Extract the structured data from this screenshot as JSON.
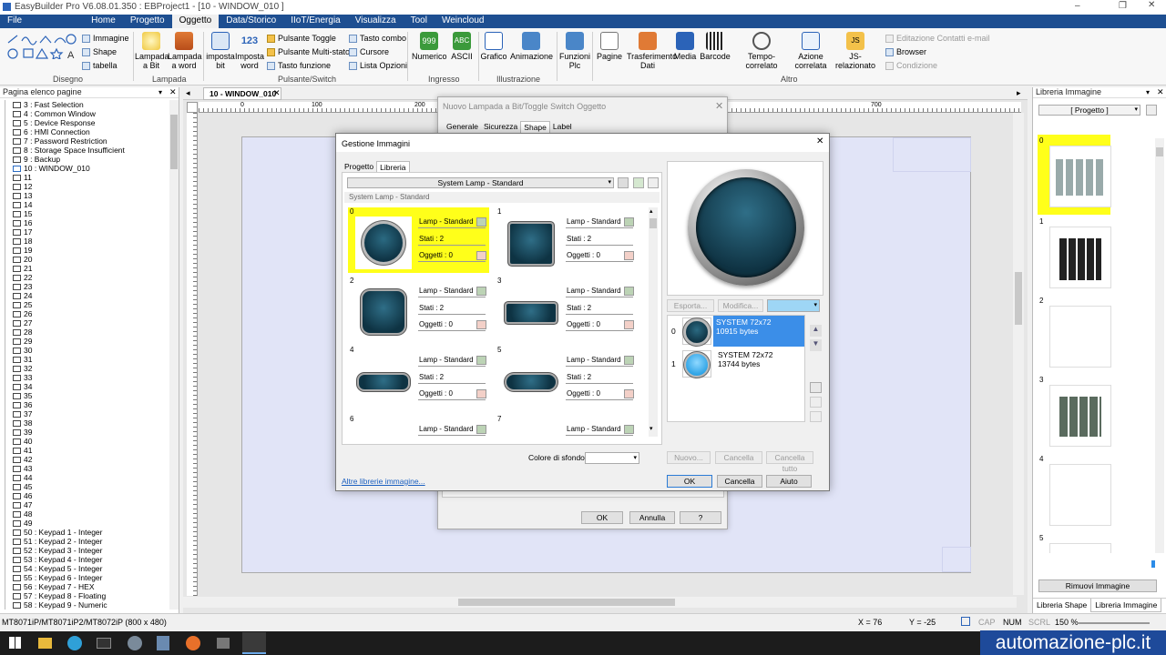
{
  "title": "EasyBuilder Pro V6.08.01.350 : EBProject1 - [10 - WINDOW_010 ]",
  "menu": [
    "File",
    "Home",
    "Progetto",
    "Oggetto",
    "Data/Storico",
    "IIoT/Energia",
    "Visualizza",
    "Tool",
    "Weincloud"
  ],
  "ribbon": {
    "disegno": {
      "label": "Disegno",
      "immagine": "Immagine",
      "shape": "Shape",
      "tabella": "tabella"
    },
    "lampada": {
      "label": "Lampada",
      "bit": "Lampada a Bit",
      "word": "Lampada a word"
    },
    "pulsante": {
      "label": "Pulsante/Switch",
      "imposta_bit": "imposta bit",
      "imposta_word": "Imposta word",
      "toggle": "Pulsante Toggle",
      "multi": "Pulsante Multi-stato",
      "funzione": "Tasto funzione",
      "combo": "Tasto combo",
      "cursore": "Cursore",
      "lista": "Lista Opzioni"
    },
    "ingresso": {
      "label": "Ingresso",
      "numerico": "Numerico",
      "ascii": "ASCII"
    },
    "illustrazione": {
      "label": "Illustrazione",
      "grafico": "Grafico",
      "animazione": "Animazione"
    },
    "funzioni_plc": "Funzioni Plc",
    "altro": {
      "label": "Altro",
      "pagine": "Pagine",
      "trasferimento": "Trasferimento Dati",
      "media": "Media",
      "barcode": "Barcode",
      "tempo": "Tempo-correlato",
      "azione": "Azione correlata",
      "js": "JS-relazionato",
      "edit_contatti": "Editazione Contatti e-mail",
      "browser": "Browser",
      "condizione": "Condizione"
    }
  },
  "left_panel": {
    "header": "Pagina elenco pagine",
    "pages": [
      "3 : Fast Selection",
      "4 : Common Window",
      "5 : Device Response",
      "6 : HMI Connection",
      "7 : Password Restriction",
      "8 : Storage Space Insufficient",
      "9 : Backup",
      "10 : WINDOW_010",
      "11",
      "12",
      "13",
      "14",
      "15",
      "16",
      "17",
      "18",
      "19",
      "20",
      "21",
      "22",
      "23",
      "24",
      "25",
      "26",
      "27",
      "28",
      "29",
      "30",
      "31",
      "32",
      "33",
      "34",
      "35",
      "36",
      "37",
      "38",
      "39",
      "40",
      "41",
      "42",
      "43",
      "44",
      "45",
      "46",
      "47",
      "48",
      "49",
      "50 : Keypad 1 - Integer",
      "51 : Keypad 2 - Integer",
      "52 : Keypad 3 - Integer",
      "53 : Keypad 4 - Integer",
      "54 : Keypad 5 - Integer",
      "55 : Keypad 6 - Integer",
      "56 : Keypad 7 - HEX",
      "57 : Keypad 8 - Floating",
      "58 : Keypad 9 - Numeric"
    ]
  },
  "doc_tab": "10 - WINDOW_010",
  "ruler_ticks": [
    "0",
    "100",
    "200",
    "700"
  ],
  "bg_dialog": {
    "title": "Nuovo  Lampada a Bit/Toggle Switch Oggetto",
    "tabs": [
      "Generale",
      "Sicurezza",
      "Shape",
      "Label"
    ],
    "ok": "OK",
    "annulla": "Annulla",
    "help": "?"
  },
  "dialog": {
    "title": "Gestione Immagini",
    "tabs": [
      "Progetto",
      "Libreria"
    ],
    "library_select": "System Lamp - Standard",
    "library_caption": "System Lamp - Standard",
    "items": [
      {
        "id": "0",
        "name": "Lamp - Standard",
        "stati": "Stati : 2",
        "oggetti": "Oggetti : 0"
      },
      {
        "id": "1",
        "name": "Lamp - Standard",
        "stati": "Stati : 2",
        "oggetti": "Oggetti : 0"
      },
      {
        "id": "2",
        "name": "Lamp - Standard",
        "stati": "Stati : 2",
        "oggetti": "Oggetti : 0"
      },
      {
        "id": "3",
        "name": "Lamp - Standard",
        "stati": "Stati : 2",
        "oggetti": "Oggetti : 0"
      },
      {
        "id": "4",
        "name": "Lamp - Standard",
        "stati": "Stati : 2",
        "oggetti": "Oggetti : 0"
      },
      {
        "id": "5",
        "name": "Lamp - Standard",
        "stati": "Stati : 2",
        "oggetti": "Oggetti : 0"
      },
      {
        "id": "6",
        "name": "Lamp - Standard"
      },
      {
        "id": "7",
        "name": "Lamp - Standard"
      }
    ],
    "esporta": "Esporta...",
    "modifica": "Modifica...",
    "states": [
      {
        "idx": "0",
        "name": "SYSTEM 72x72",
        "size": "10915 bytes"
      },
      {
        "idx": "1",
        "name": "SYSTEM 72x72",
        "size": "13744 bytes"
      }
    ],
    "nuovo": "Nuovo...",
    "cancella": "Cancella",
    "cancella_tutto": "Cancella tutto",
    "sfondo_label": "Colore di sfondo :",
    "link": "Altre librerie immagine...",
    "ok": "OK",
    "cancel": "Cancella",
    "help": "Aiuto",
    "selected_color": "#ffff1a"
  },
  "right_panel": {
    "header": "Libreria Immagine",
    "select": "[ Progetto ]",
    "thumbs": [
      "0",
      "1",
      "2",
      "3",
      "4",
      "5"
    ],
    "remove": "Rimuovi Immagine",
    "tabs": [
      "Libreria Shape",
      "Libreria Immagine"
    ]
  },
  "status": {
    "model": "MT8071iP/MT8071iP2/MT8072iP (800 x 480)",
    "x": "X = 76",
    "y": "Y = -25",
    "cap": "CAP",
    "num": "NUM",
    "scrl": "SCRL",
    "zoom": "150 %"
  },
  "brand": "automazione-plc.it"
}
